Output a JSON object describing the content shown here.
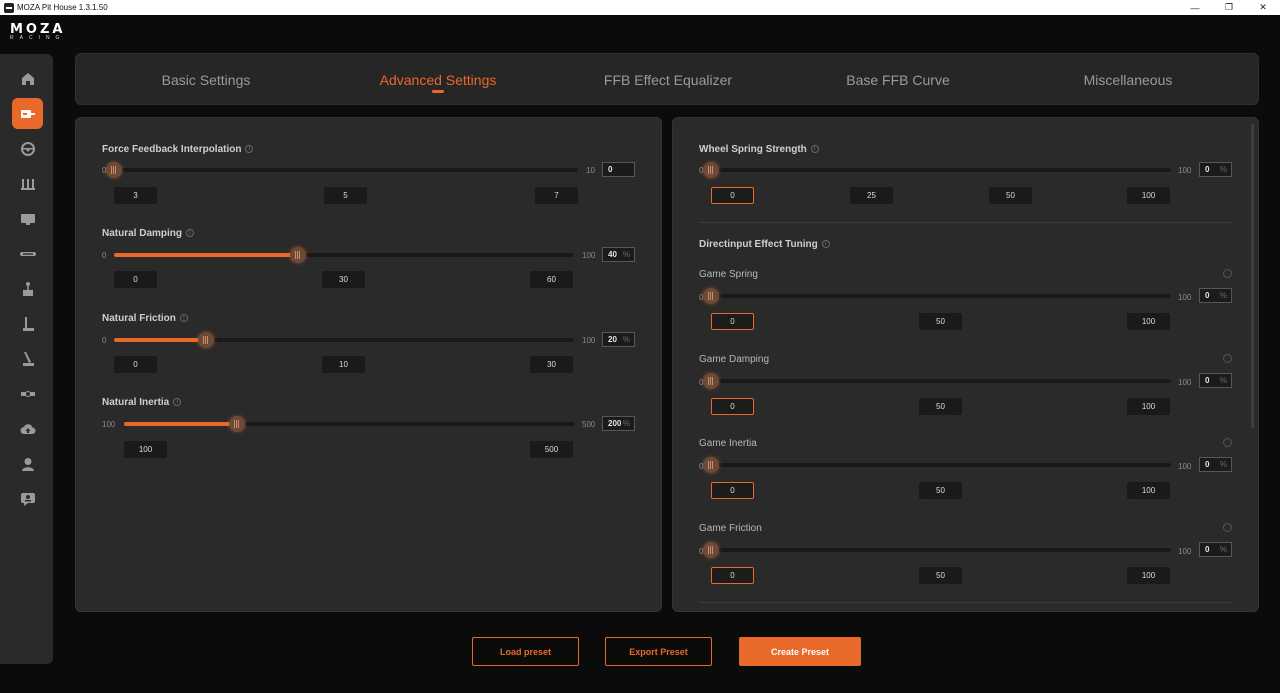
{
  "window": {
    "title": "MOZA Pit House 1.3.1.50",
    "min": "—",
    "restore": "❐",
    "close": "✕"
  },
  "logo": {
    "line1": "MOZA",
    "line2": "RACING"
  },
  "colors": {
    "accent": "#e8692a",
    "panel": "#2a2a2a",
    "background": "#0b0b0b"
  },
  "sidebar": {
    "items": [
      {
        "name": "home-icon",
        "active": false
      },
      {
        "name": "wheelbase-icon",
        "active": true
      },
      {
        "name": "steering-wheel-icon",
        "active": false
      },
      {
        "name": "pedals-icon",
        "active": false
      },
      {
        "name": "dashboard-icon",
        "active": false
      },
      {
        "name": "display-bar-icon",
        "active": false
      },
      {
        "name": "shifter-icon",
        "active": false
      },
      {
        "name": "handbrake-icon",
        "active": false
      },
      {
        "name": "sequential-shifter-icon",
        "active": false
      },
      {
        "name": "hub-icon",
        "active": false
      },
      {
        "name": "cloud-upload-icon",
        "active": false
      },
      {
        "name": "user-icon",
        "active": false
      },
      {
        "name": "support-icon",
        "active": false
      }
    ]
  },
  "tabs": [
    {
      "label": "Basic Settings",
      "active": false
    },
    {
      "label": "Advanced Settings",
      "active": true
    },
    {
      "label": "FFB Effect Equalizer",
      "active": false
    },
    {
      "label": "Base FFB Curve",
      "active": false
    },
    {
      "label": "Miscellaneous",
      "active": false
    }
  ],
  "left": {
    "ffb_interp": {
      "label": "Force Feedback Interpolation",
      "min": "0",
      "max": "10",
      "value": "0",
      "presets": [
        "3",
        "5",
        "7"
      ]
    },
    "natural_damping": {
      "label": "Natural Damping",
      "min": "0",
      "max": "100",
      "value": "40",
      "unit": "%",
      "presets": [
        "0",
        "30",
        "60"
      ]
    },
    "natural_friction": {
      "label": "Natural Friction",
      "min": "0",
      "max": "100",
      "value": "20",
      "unit": "%",
      "presets": [
        "0",
        "10",
        "30"
      ]
    },
    "natural_inertia": {
      "label": "Natural Inertia",
      "min": "100",
      "max": "500",
      "value": "200",
      "unit": "%",
      "presets": [
        "100",
        "500"
      ]
    }
  },
  "right": {
    "wheel_spring": {
      "label": "Wheel Spring Strength",
      "min": "0",
      "max": "100",
      "value": "0",
      "unit": "%",
      "presets": [
        "0",
        "25",
        "50",
        "100"
      ]
    },
    "directinput": {
      "label": "Directinput Effect Tuning"
    },
    "game_spring": {
      "label": "Game Spring",
      "min": "0",
      "max": "100",
      "value": "0",
      "unit": "%",
      "presets": [
        "0",
        "50",
        "100"
      ]
    },
    "game_damping": {
      "label": "Game Damping",
      "min": "0",
      "max": "100",
      "value": "0",
      "unit": "%",
      "presets": [
        "0",
        "50",
        "100"
      ]
    },
    "game_inertia": {
      "label": "Game Inertia",
      "min": "0",
      "max": "100",
      "value": "0",
      "unit": "%",
      "presets": [
        "0",
        "50",
        "100"
      ]
    },
    "game_friction": {
      "label": "Game Friction",
      "min": "0",
      "max": "100",
      "value": "0",
      "unit": "%",
      "presets": [
        "0",
        "50",
        "100"
      ]
    }
  },
  "footer": {
    "load": "Load preset",
    "export": "Export Preset",
    "create": "Create Preset"
  }
}
